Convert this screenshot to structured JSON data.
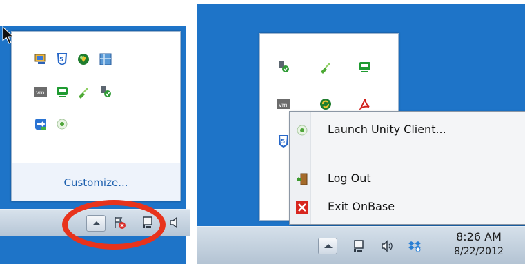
{
  "left_panel": {
    "overflow_customize_link": "Customize...",
    "tray_icons": [
      "notification-monitor-icon",
      "skype-s-icon",
      "update-shield-icon",
      "grid-app-icon",
      "vmware-vm-icon",
      "green-chat-icon",
      "usb-green-icon",
      "usb-check-icon",
      "teamviewer-icon",
      "unity-client-icon"
    ],
    "taskbar_icons": [
      "show-hidden-icons-button",
      "action-center-flag-error-icon",
      "network-icon",
      "speaker-icon"
    ],
    "highlight_color": "#e8331c"
  },
  "right_panel": {
    "tray_icons": [
      "usb-check-icon",
      "usb-green-icon",
      "green-chat-icon",
      "vmware-vm-icon",
      "update-refresh-icon",
      "acrobat-icon",
      "skype-s-icon"
    ],
    "context_menu": {
      "items": [
        {
          "label": "Launch Unity Client...",
          "icon": "unity-client-icon"
        },
        {
          "label": "Log Out",
          "icon": "log-out-door-icon"
        },
        {
          "label": "Exit OnBase",
          "icon": "exit-red-x-icon"
        }
      ]
    },
    "clock": {
      "time": "8:26 AM",
      "date": "8/22/2012"
    },
    "taskbar_icons": [
      "show-hidden-icons-button",
      "network-icon",
      "speaker-icon",
      "dropbox-icon"
    ]
  },
  "colors": {
    "desktop": "#1e74c8",
    "link": "#1c5fae",
    "annotation_circle": "#e8331c"
  }
}
